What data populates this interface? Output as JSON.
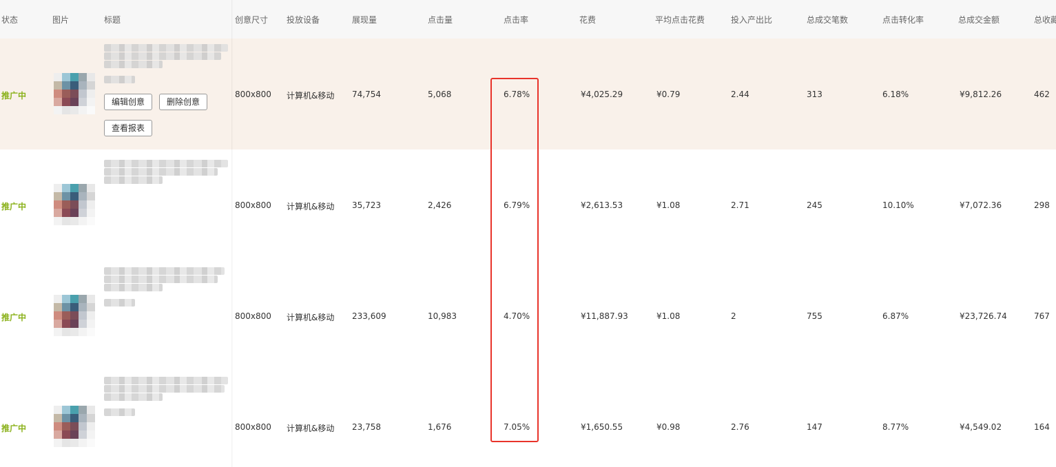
{
  "columns": {
    "status": "状态",
    "image": "图片",
    "title": "标题",
    "size": "创意尺寸",
    "device": "投放设备",
    "impressions": "展现量",
    "clicks": "点击量",
    "ctr": "点击率",
    "cost": "花费",
    "cpc": "平均点击花费",
    "roi": "投入产出比",
    "orders": "总成交笔数",
    "cvr": "点击转化率",
    "gmv": "总成交金额",
    "fav": "总收藏"
  },
  "actions": {
    "edit": "编辑创意",
    "delete": "删除创意",
    "report": "查看报表"
  },
  "rows": [
    {
      "status": "推广中",
      "size": "800x800",
      "device": "计算机&移动",
      "impressions": "74,754",
      "clicks": "5,068",
      "ctr": "6.78%",
      "cost": "¥4,025.29",
      "cpc": "¥0.79",
      "roi": "2.44",
      "orders": "313",
      "cvr": "6.18%",
      "gmv": "¥9,812.26",
      "fav": "462"
    },
    {
      "status": "推广中",
      "size": "800x800",
      "device": "计算机&移动",
      "impressions": "35,723",
      "clicks": "2,426",
      "ctr": "6.79%",
      "cost": "¥2,613.53",
      "cpc": "¥1.08",
      "roi": "2.71",
      "orders": "245",
      "cvr": "10.10%",
      "gmv": "¥7,072.36",
      "fav": "298"
    },
    {
      "status": "推广中",
      "size": "800x800",
      "device": "计算机&移动",
      "impressions": "233,609",
      "clicks": "10,983",
      "ctr": "4.70%",
      "cost": "¥11,887.93",
      "cpc": "¥1.08",
      "roi": "2",
      "orders": "755",
      "cvr": "6.87%",
      "gmv": "¥23,726.74",
      "fav": "767"
    },
    {
      "status": "推广中",
      "size": "800x800",
      "device": "计算机&移动",
      "impressions": "23,758",
      "clicks": "1,676",
      "ctr": "7.05%",
      "cost": "¥1,650.55",
      "cpc": "¥0.98",
      "roi": "2.76",
      "orders": "147",
      "cvr": "8.77%",
      "gmv": "¥4,549.02",
      "fav": "164"
    }
  ],
  "colors": {
    "status": "#8ab11a",
    "highlight_row": "#f9f1ea",
    "annotation_box": "#e8332a"
  }
}
